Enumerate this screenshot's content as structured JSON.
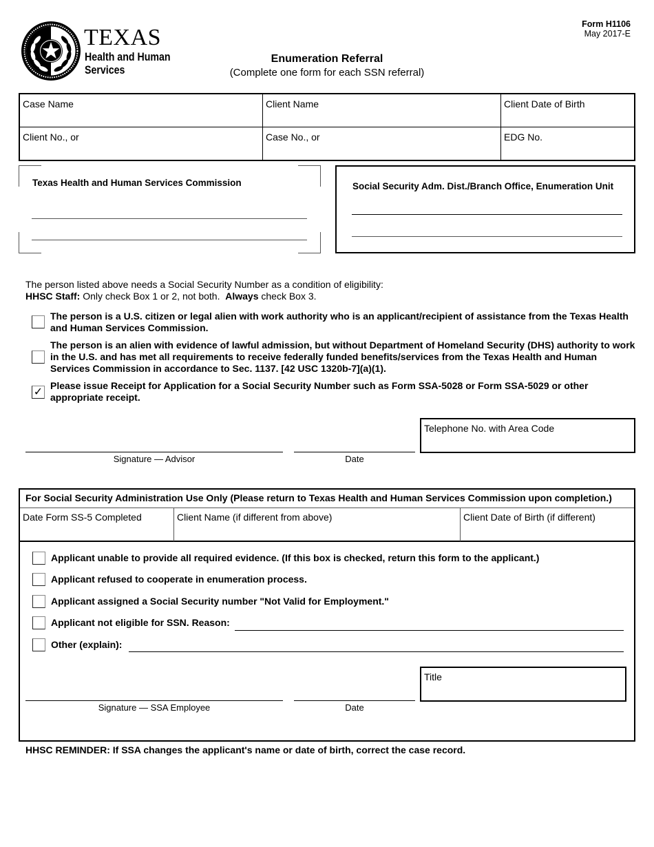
{
  "header": {
    "logo": {
      "icon": "texas-seal-star-icon",
      "line1": "TEXAS",
      "line2": "Health and Human",
      "line3": "Services"
    },
    "form_number": "Form H1106",
    "form_version": "May 2017-E",
    "title": "Enumeration Referral",
    "subtitle": "(Complete one form for each SSN referral)"
  },
  "client_info": {
    "case_name": {
      "label": "Case Name",
      "value": ""
    },
    "client_name": {
      "label": "Client Name",
      "value": ""
    },
    "client_dob": {
      "label": "Client Date of Birth",
      "value": ""
    },
    "client_no": {
      "label": "Client No., or",
      "value": ""
    },
    "case_no": {
      "label": "Case No., or",
      "value": ""
    },
    "edg_no": {
      "label": "EDG No.",
      "value": ""
    }
  },
  "addresses": {
    "hhsc": {
      "title": "Texas Health and Human Services Commission",
      "line1": "",
      "line2": ""
    },
    "ssa": {
      "title": "Social Security Adm. Dist./Branch Office, Enumeration Unit",
      "line1": "",
      "line2": ""
    }
  },
  "instructions": {
    "line1": "The person listed above needs a Social Security Number as a condition of eligibility:",
    "line2_bold": "HHSC Staff:",
    "line2_a": " Only check Box 1 or 2, not both.  ",
    "line2_bold2": "Always",
    "line2_b": " check Box 3."
  },
  "hhsc_boxes": [
    {
      "text": "The person is a U.S. citizen or legal alien with work authority who is an applicant/recipient of assistance from the Texas Health and Human Services Commission.",
      "checked": false,
      "mark": ""
    },
    {
      "text": "The person is an alien with evidence of lawful admission, but without Department of Homeland Security (DHS) authority to work in the U.S. and has met all requirements to receive federally funded benefits/services from the Texas Health and Human Services Commission in accordance to Sec. 1137. [42 USC 1320b-7](a)(1).",
      "checked": false,
      "mark": ""
    },
    {
      "text": "Please issue Receipt for Application for a Social Security Number such as Form SSA-5028 or Form SSA-5029 or other appropriate receipt.",
      "checked": true,
      "mark": "✓"
    }
  ],
  "advisor_signature": {
    "signature_label": "Signature — Advisor",
    "date_label": "Date",
    "telephone_label": "Telephone No. with Area Code",
    "telephone_value": ""
  },
  "ssa_section": {
    "header": "For Social Security Administration Use Only (Please return to Texas Health and Human Services Commission upon completion.)",
    "date_ss5": {
      "label": "Date Form SS-5 Completed",
      "value": ""
    },
    "client_name": {
      "label": "Client Name (if different from above)",
      "value": ""
    },
    "client_dob": {
      "label": "Client Date of Birth (if different)",
      "value": ""
    },
    "boxes": [
      {
        "text": "Applicant unable to provide all required evidence. (If this box is checked, return this form to the applicant.)",
        "checked": false
      },
      {
        "text": "Applicant refused to cooperate in enumeration process.",
        "checked": false
      },
      {
        "text": "Applicant assigned a Social Security number \"Not Valid for Employment.\"",
        "checked": false
      },
      {
        "text": "Applicant not eligible for SSN. Reason:",
        "checked": false,
        "fill": ""
      },
      {
        "text": "Other (explain):",
        "checked": false,
        "fill": ""
      }
    ],
    "signature_label": "Signature — SSA Employee",
    "date_label": "Date",
    "title_label": "Title",
    "title_value": ""
  },
  "reminder": "HHSC REMINDER: If SSA changes the applicant's name or date of birth, correct the case record."
}
